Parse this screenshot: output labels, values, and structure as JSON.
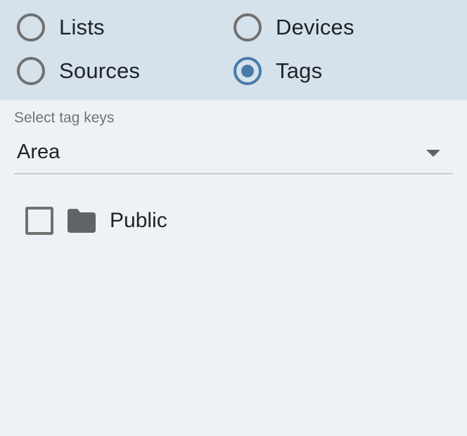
{
  "source_filter": {
    "options": [
      {
        "id": "lists",
        "label": "Lists",
        "selected": false
      },
      {
        "id": "devices",
        "label": "Devices",
        "selected": false
      },
      {
        "id": "sources",
        "label": "Sources",
        "selected": false
      },
      {
        "id": "tags",
        "label": "Tags",
        "selected": true
      }
    ]
  },
  "tag_select": {
    "label": "Select tag keys",
    "value": "Area",
    "icon": "dropdown-arrow-icon"
  },
  "tree": {
    "items": [
      {
        "label": "Public",
        "checked": false,
        "icon": "folder-icon"
      }
    ]
  },
  "colors": {
    "header_background": "#d5e1eb",
    "page_background": "#edf2f7",
    "accent": "#4a7ba7",
    "icon_gray": "#707070"
  }
}
